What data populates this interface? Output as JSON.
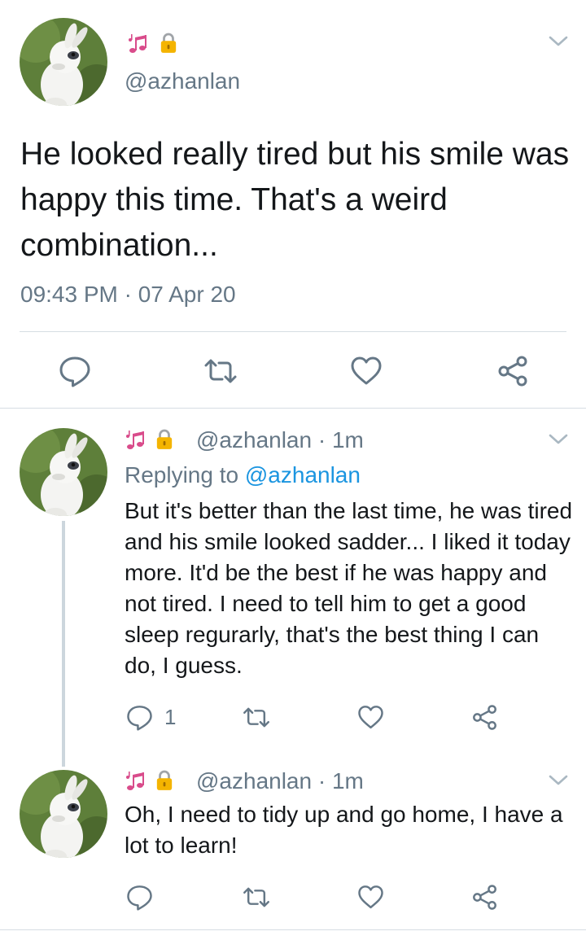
{
  "main_tweet": {
    "emoji": [
      "music-notes",
      "lock"
    ],
    "handle": "@azhanlan",
    "text": "He looked really tired but his smile was happy this time. That's a weird combination...",
    "timestamp": "09:43 PM · 07 Apr 20"
  },
  "replies": [
    {
      "handle_time": "@azhanlan · 1m",
      "replying_prefix": "Replying to ",
      "replying_mention": "@azhanlan",
      "text": "But it's better than the last time, he was tired and his smile looked sadder... I liked it today more. It'd be the best if he was happy and not tired. I need to tell him to get a good sleep regurarly, that's the best thing I can do, I guess.",
      "reply_count": "1"
    },
    {
      "handle_time": "@azhanlan · 1m",
      "text": "Oh, I need to tidy up and go home, I have a lot to learn!"
    }
  ],
  "icons": {
    "reply": "reply-icon",
    "retweet": "retweet-icon",
    "like": "heart-icon",
    "share": "share-icon",
    "more": "chevron-down-icon"
  },
  "colors": {
    "icon_gray": "#657786",
    "link_blue": "#1b95e0",
    "emoji_pink": "#d94c8b",
    "lock_gold": "#f4b400",
    "divider": "#d6dde3",
    "thread_line": "#ccd6dd"
  }
}
